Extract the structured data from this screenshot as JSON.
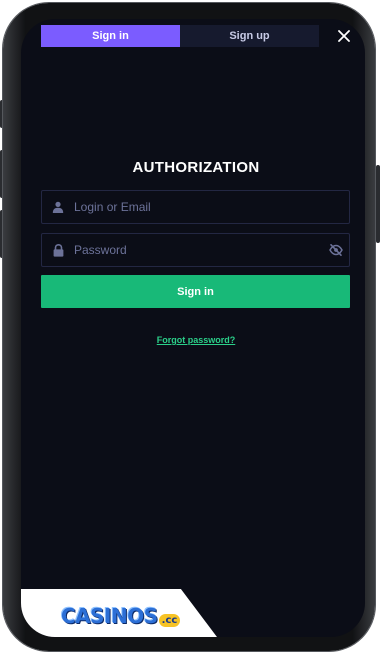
{
  "tabs": [
    {
      "label": "Sign in",
      "active": true
    },
    {
      "label": "Sign up",
      "active": false
    }
  ],
  "title": "AUTHORIZATION",
  "login_field": {
    "placeholder": "Login or Email",
    "value": "",
    "icon": "user-icon"
  },
  "password_field": {
    "placeholder": "Password",
    "value": "",
    "icon": "lock-icon",
    "toggle_icon": "eye-off-icon"
  },
  "submit_label": "Sign in",
  "forgot_label": "Forgot password?",
  "logo": {
    "text": "CASINOS",
    "suffix": ".cc"
  },
  "colors": {
    "background": "#0b0d17",
    "tab_active": "#7b5cff",
    "tab_inactive": "#161a2e",
    "primary_button": "#18b978",
    "link": "#2bd08a"
  }
}
